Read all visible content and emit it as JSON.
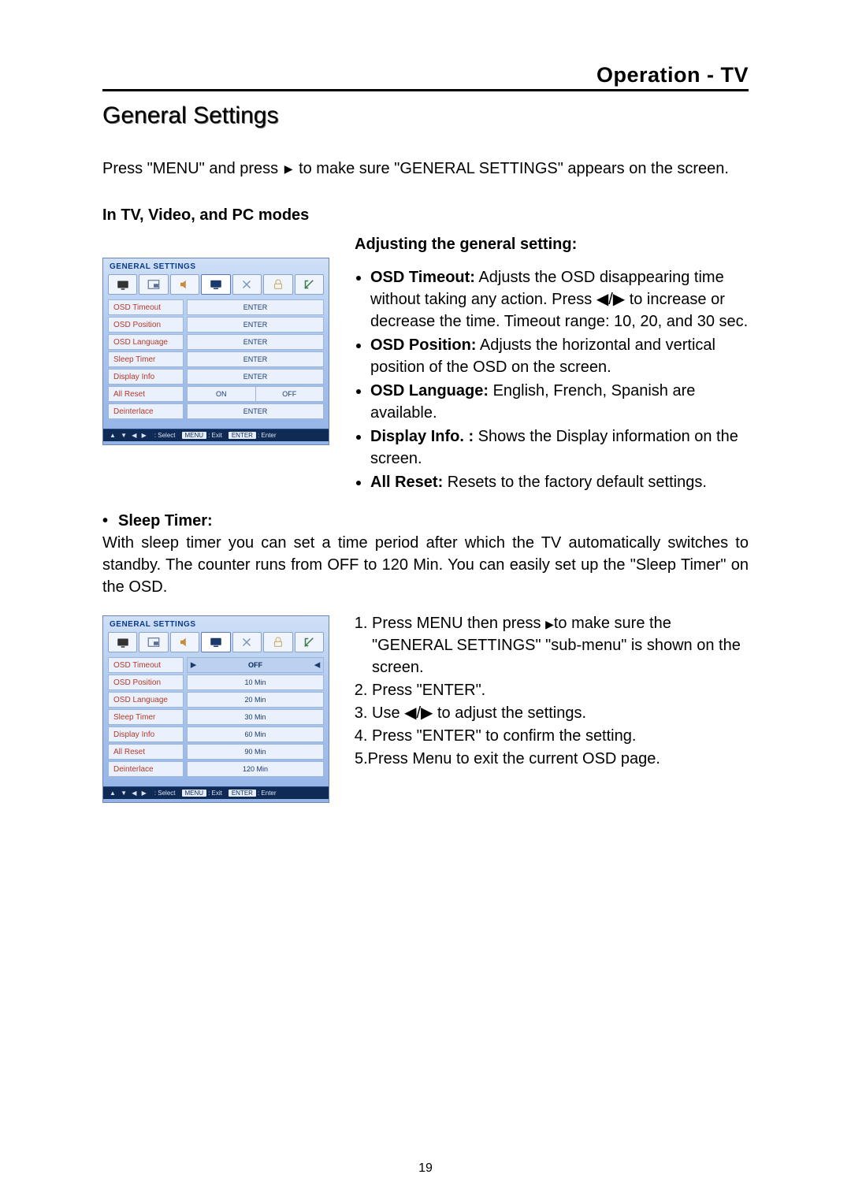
{
  "header": {
    "title": "Operation - TV"
  },
  "section_title": "General Settings",
  "intro": {
    "pre": "Press \"MENU\" and press",
    "arrow": "▶",
    "post": "to make sure \"GENERAL SETTINGS\" appears on the screen."
  },
  "modes_heading": "In TV, Video, and PC modes",
  "adjust_heading": "Adjusting the general setting:",
  "bullets": [
    {
      "term": "OSD Timeout:",
      "text": "  Adjusts the OSD disappearing time without taking any action. Press ◀/▶ to increase or decrease the time. Timeout range: 10, 20, and 30 sec."
    },
    {
      "term": "OSD Position:",
      "text": "  Adjusts the horizontal and vertical position of the OSD on the screen."
    },
    {
      "term": "OSD Language:",
      "text": " English, French, Spanish are available."
    },
    {
      "term": "Display Info. :",
      "text": " Shows the Display information on the screen."
    },
    {
      "term": "All Reset:",
      "text": " Resets to the factory default settings."
    }
  ],
  "sleep": {
    "title": "Sleep Timer:",
    "text": "With sleep timer you can set a time period after which the TV automatically switches to standby. The counter runs from OFF to 120 Min. You can easily set up the \"Sleep Timer\" on the OSD."
  },
  "steps": {
    "s1a": "Press MENU then press ",
    "s1_arrow": "▶",
    "s1b": "to make sure the \"GENERAL SETTINGS\" \"sub-menu\" is shown on the screen.",
    "s2": "Press \"ENTER\".",
    "s3": "Use ◀/▶  to adjust the settings.",
    "s4": "Press \"ENTER\" to confirm the setting.",
    "s5": "5.Press Menu to exit the current OSD page."
  },
  "osd1": {
    "title": "GENERAL SETTINGS",
    "rows": [
      {
        "label": "OSD Timeout",
        "value": "ENTER"
      },
      {
        "label": "OSD Position",
        "value": "ENTER"
      },
      {
        "label": "OSD Language",
        "value": "ENTER"
      },
      {
        "label": "Sleep Timer",
        "value": "ENTER"
      },
      {
        "label": "Display Info",
        "value": "ENTER"
      },
      {
        "label": "All Reset",
        "on": "ON",
        "off": "OFF"
      },
      {
        "label": "Deinterlace",
        "value": "ENTER"
      }
    ],
    "footer": {
      "glyphs": "▲ ▼ ◀ ▶",
      "select": ": Select",
      "menu_key": "MENU",
      "exit": ": Exit",
      "enter_key": "ENTER",
      "enter": ": Enter"
    }
  },
  "osd2": {
    "title": "GENERAL SETTINGS",
    "rows": [
      {
        "label": "OSD Timeout",
        "value": "OFF",
        "selected": true,
        "arrows": true
      },
      {
        "label": "OSD Position",
        "value": "10 Min"
      },
      {
        "label": "OSD Language",
        "value": "20 Min"
      },
      {
        "label": "Sleep Timer",
        "value": "30 Min"
      },
      {
        "label": "Display Info",
        "value": "60 Min"
      },
      {
        "label": "All Reset",
        "value": "90 Min"
      },
      {
        "label": "Deinterlace",
        "value": "120 Min"
      }
    ],
    "footer": {
      "glyphs": "▲ ▼ ◀ ▶",
      "select": ": Select",
      "menu_key": "MENU",
      "exit": ": Exit",
      "enter_key": "ENTER",
      "enter": ": Enter"
    }
  },
  "page_number": "19"
}
